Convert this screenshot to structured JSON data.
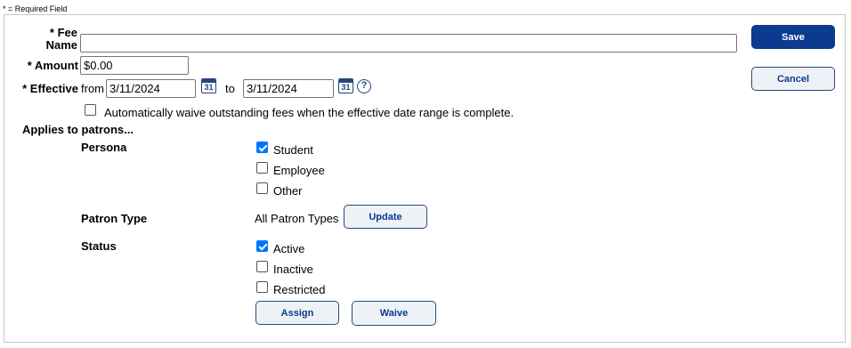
{
  "required_note": "* = Required Field",
  "fee_name": {
    "label_line1": "* Fee",
    "label_line2": "Name",
    "value": ""
  },
  "amount": {
    "label": "* Amount",
    "value": "$0.00"
  },
  "effective": {
    "label": "* Effective",
    "from_label": "from",
    "from_value": "3/11/2024",
    "to_label": "to",
    "to_value": "3/11/2024",
    "calendar_day": "31",
    "help_glyph": "?"
  },
  "auto_waive": {
    "label": "Automatically waive outstanding fees when the effective date range is complete.",
    "checked": false
  },
  "applies_heading": "Applies to patrons...",
  "persona": {
    "label": "Persona",
    "options": [
      {
        "label": "Student",
        "checked": true
      },
      {
        "label": "Employee",
        "checked": false
      },
      {
        "label": "Other",
        "checked": false
      }
    ]
  },
  "patron_type": {
    "label": "Patron Type",
    "value": "All Patron Types",
    "button": "Update"
  },
  "status": {
    "label": "Status",
    "options": [
      {
        "label": "Active",
        "checked": true
      },
      {
        "label": "Inactive",
        "checked": false
      },
      {
        "label": "Restricted",
        "checked": false
      }
    ]
  },
  "buttons": {
    "save": "Save",
    "cancel": "Cancel",
    "assign": "Assign",
    "waive": "Waive"
  },
  "colors": {
    "primary": "#0b3a8f",
    "checkbox": "#0075ff",
    "border": "#c8c8c8"
  },
  "icons": {
    "calendar": "calendar-icon",
    "help": "help-icon"
  }
}
